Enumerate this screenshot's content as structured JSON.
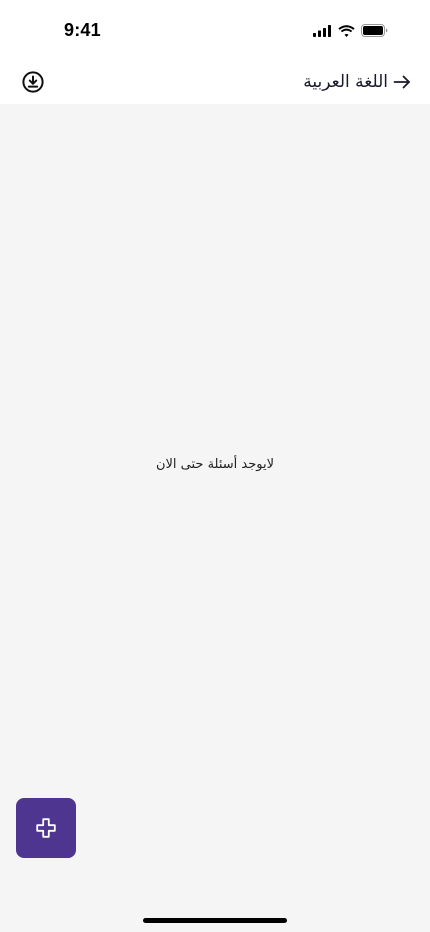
{
  "status_bar": {
    "time": "9:41"
  },
  "header": {
    "back_label": "اللغة العربية",
    "back_icon": "arrow-right-icon",
    "download_icon": "download-circle-icon"
  },
  "main": {
    "empty_message": "لايوجد أسئلة حتى الان"
  },
  "fab": {
    "icon": "plus-icon",
    "color": "#4d3590"
  },
  "colors": {
    "header_bg": "#ffffff",
    "content_bg": "#f5f5f5",
    "accent": "#4d3590"
  }
}
